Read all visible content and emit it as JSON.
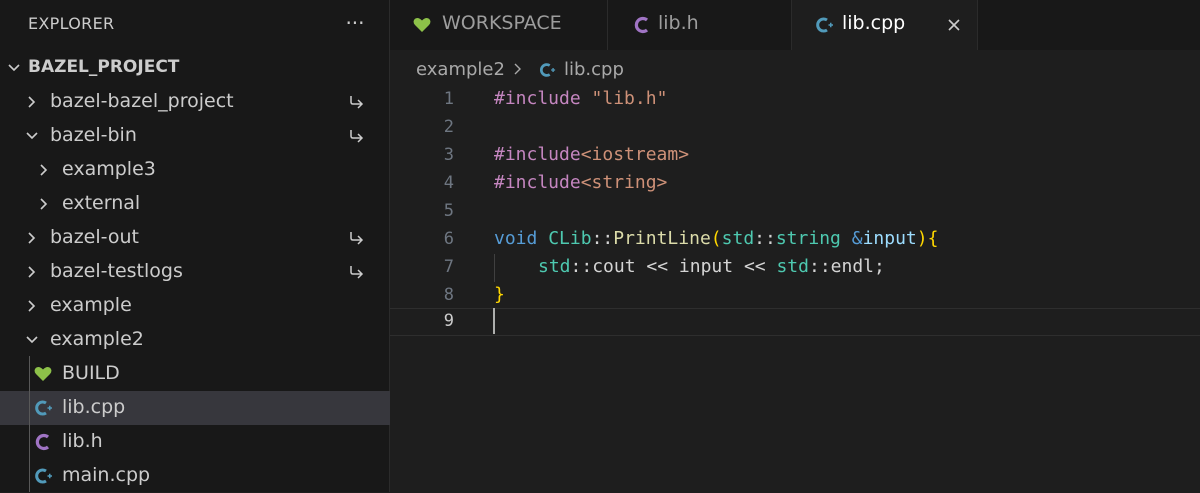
{
  "explorer": {
    "title": "EXPLORER",
    "more_actions": "···",
    "root": "BAZEL_PROJECT",
    "items": [
      {
        "label": "bazel-bazel_project"
      },
      {
        "label": "bazel-bin"
      },
      {
        "label": "example3"
      },
      {
        "label": "external"
      },
      {
        "label": "bazel-out"
      },
      {
        "label": "bazel-testlogs"
      },
      {
        "label": "example"
      },
      {
        "label": "example2"
      },
      {
        "label": "BUILD"
      },
      {
        "label": "lib.cpp"
      },
      {
        "label": "lib.h"
      },
      {
        "label": "main.cpp"
      }
    ]
  },
  "tabs": [
    {
      "label": "WORKSPACE"
    },
    {
      "label": "lib.h"
    },
    {
      "label": "lib.cpp"
    }
  ],
  "breadcrumb": {
    "folder": "example2",
    "file": "lib.cpp"
  },
  "editor": {
    "lines": [
      {
        "num": "1",
        "t": {
          "a": "#include",
          "b": " ",
          "c": "\"lib.h\""
        }
      },
      {
        "num": "2"
      },
      {
        "num": "3",
        "t": {
          "a": "#include",
          "b": "<iostream>"
        }
      },
      {
        "num": "4",
        "t": {
          "a": "#include",
          "b": "<string>"
        }
      },
      {
        "num": "5"
      },
      {
        "num": "6",
        "t": {
          "void": "void",
          "cls": "CLib",
          "sep": "::",
          "fn": "PrintLine",
          "lp": "(",
          "std": "std",
          "sep2": "::",
          "type": "string",
          "amp": " &",
          "param": "input",
          "rp": ")",
          "lb": "{"
        }
      },
      {
        "num": "7",
        "t": {
          "std": "std",
          "sep": "::",
          "cout": "cout",
          "op1": " << ",
          "input": "input",
          "op2": " << ",
          "std2": "std",
          "sep2": "::",
          "endl": "endl",
          "semi": ";"
        }
      },
      {
        "num": "8",
        "t": {
          "rb": "}"
        }
      },
      {
        "num": "9"
      }
    ]
  },
  "colors": {
    "build_icon": "#8dc149",
    "cpp_icon": "#519aba",
    "c_header_icon": "#a074c4",
    "selected_row": "#37373d",
    "editor_bg": "#1e1e1e",
    "sidebar_bg": "#181818"
  },
  "icons": {
    "chevron_right": "chevron-right-icon",
    "chevron_down": "chevron-down-icon",
    "symlink": "symlink-arrow-icon",
    "build": "heart-icon",
    "cpp": "cpp-file-icon",
    "header": "c-header-file-icon",
    "close": "close-icon"
  }
}
